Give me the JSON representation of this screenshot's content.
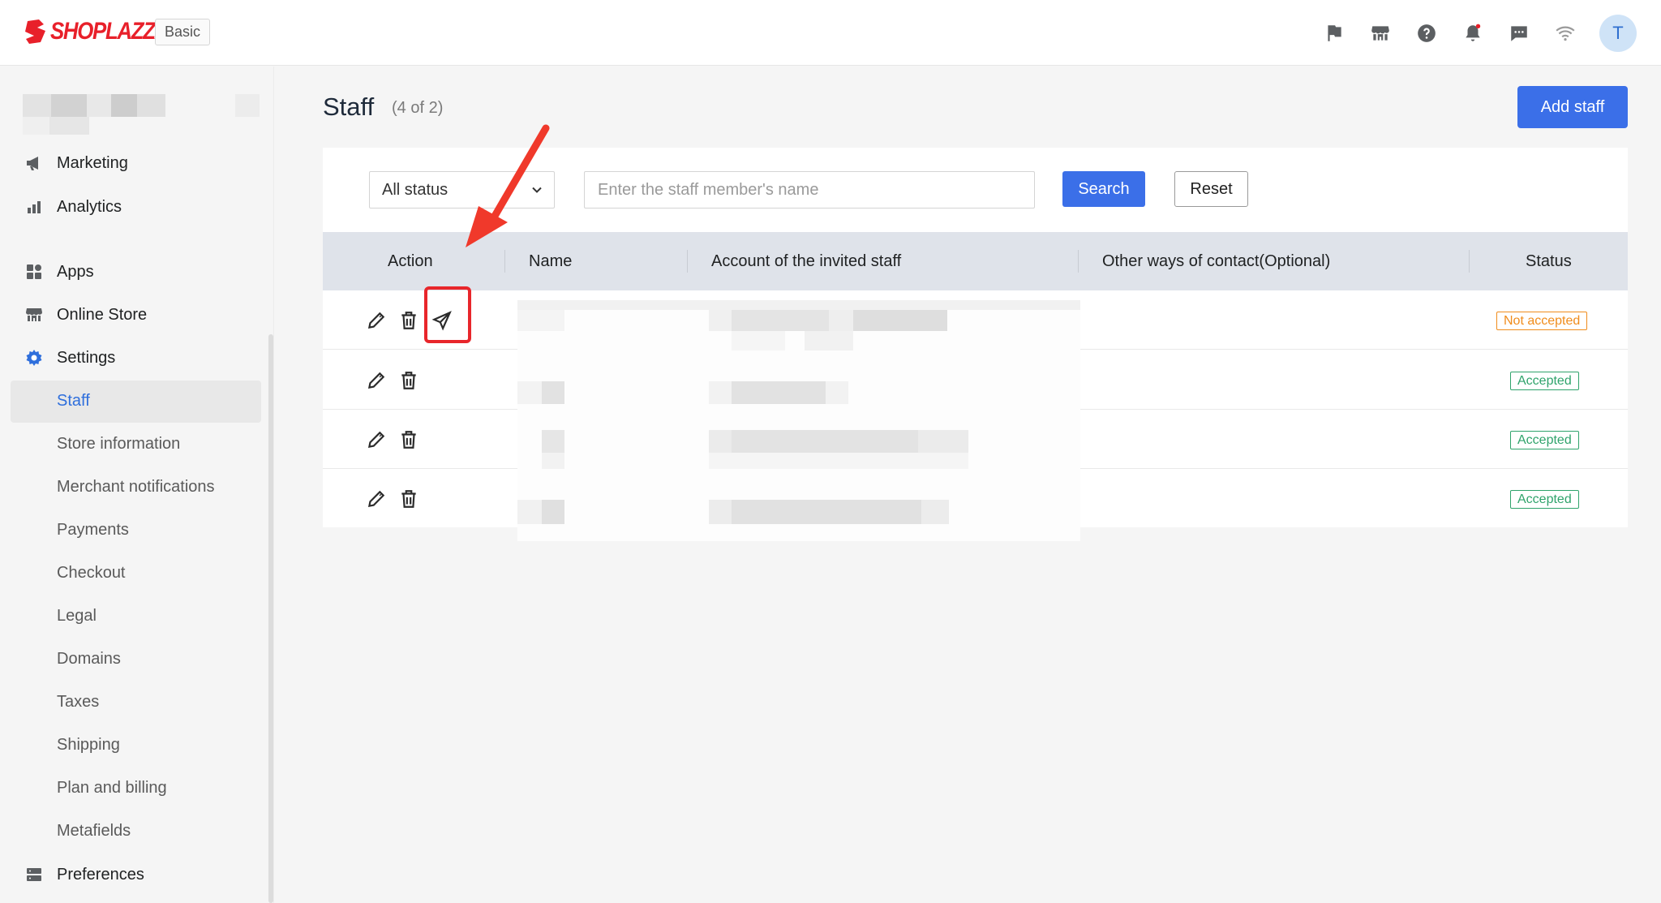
{
  "brand": {
    "name": "SHOPLAZZA",
    "plan": "Basic",
    "color": "#e8202a"
  },
  "topbar": {
    "icons": [
      "flag-icon",
      "store-icon",
      "help-icon",
      "bell-icon",
      "chat-icon",
      "wifi-icon"
    ],
    "avatar_initial": "T"
  },
  "sidebar": {
    "items": [
      {
        "label": "Marketing",
        "icon": "megaphone-icon"
      },
      {
        "label": "Analytics",
        "icon": "bar-chart-icon"
      },
      {
        "label": "Apps",
        "icon": "apps-icon"
      },
      {
        "label": "Online Store",
        "icon": "storefront-icon"
      },
      {
        "label": "Settings",
        "icon": "gear-icon"
      }
    ],
    "settings_sub": [
      "Staff",
      "Store information",
      "Merchant notifications",
      "Payments",
      "Checkout",
      "Legal",
      "Domains",
      "Taxes",
      "Shipping",
      "Plan and billing",
      "Metafields"
    ],
    "active_sub": "Staff",
    "preferences": {
      "label": "Preferences",
      "icon": "server-icon"
    }
  },
  "page": {
    "title": "Staff",
    "count": "(4 of 2)",
    "add_button": "Add staff"
  },
  "filters": {
    "status_value": "All status",
    "name_placeholder": "Enter the staff member's name",
    "search_label": "Search",
    "reset_label": "Reset"
  },
  "table": {
    "columns": [
      "Action",
      "Name",
      "Account of the invited staff",
      "Other ways of contact(Optional)",
      "Status"
    ],
    "rows": [
      {
        "status": "Not accepted",
        "actions": [
          "edit-icon",
          "trash-icon",
          "send-icon"
        ]
      },
      {
        "status": "Accepted",
        "actions": [
          "edit-icon",
          "trash-icon"
        ]
      },
      {
        "status": "Accepted",
        "actions": [
          "edit-icon",
          "trash-icon"
        ]
      },
      {
        "status": "Accepted",
        "actions": [
          "edit-icon",
          "trash-icon"
        ]
      }
    ]
  },
  "colors": {
    "primary": "#3b6fe8",
    "accepted": "#2fa36b",
    "not_accepted": "#f08c1c",
    "annotation": "#e8262b"
  }
}
